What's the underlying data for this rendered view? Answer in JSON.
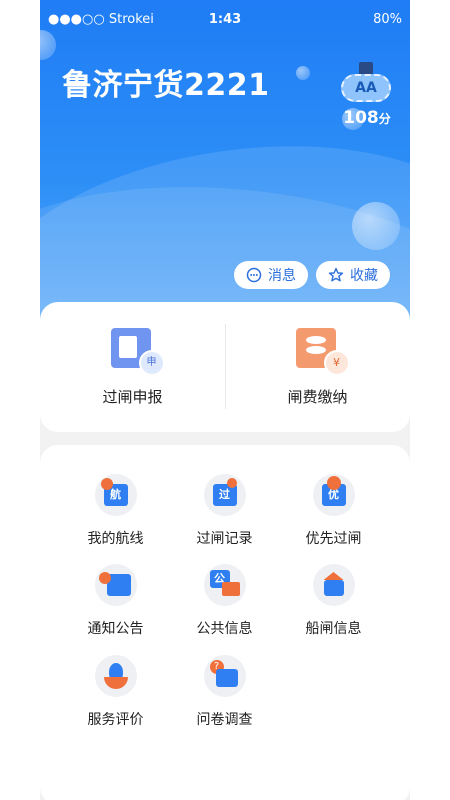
{
  "status_bar": {
    "carrier": "●●●○○ Strokei",
    "time": "1:43",
    "battery": "80%"
  },
  "header": {
    "title": "鲁济宁货2221",
    "level_badge": "AA",
    "score_value": "108",
    "score_unit": "分",
    "buttons": {
      "messages": "消息",
      "favorites": "收藏"
    }
  },
  "quick_actions": [
    {
      "label": "过闸申报",
      "icon": "declaration-icon"
    },
    {
      "label": "闸费缴纳",
      "icon": "fee-payment-icon"
    }
  ],
  "services": [
    {
      "label": "我的航线",
      "icon_text": "航"
    },
    {
      "label": "过闸记录",
      "icon_text": "过"
    },
    {
      "label": "优先过闸",
      "icon_text": "优"
    },
    {
      "label": "通知公告",
      "icon_text": ""
    },
    {
      "label": "公共信息",
      "icon_text": "公"
    },
    {
      "label": "船闸信息",
      "icon_text": ""
    },
    {
      "label": "服务评价",
      "icon_text": ""
    },
    {
      "label": "问卷调查",
      "icon_text": "?"
    }
  ],
  "colors": {
    "primary": "#2d8ff6",
    "accent": "#f0703c",
    "icon_blue": "#2f7ff3"
  }
}
